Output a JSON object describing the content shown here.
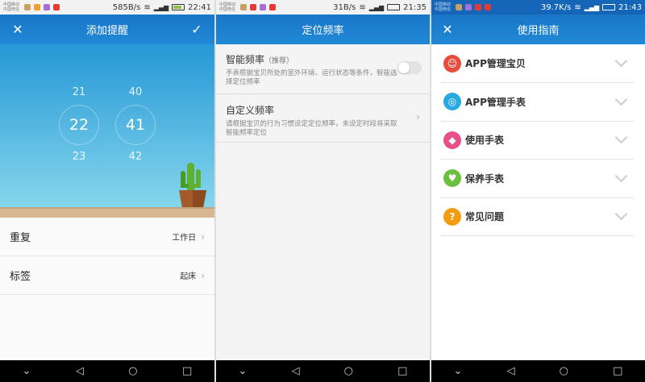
{
  "panel1": {
    "status": {
      "carrier1": "中国移动",
      "carrier2": "中国电信",
      "speed": "585B/s",
      "time": "22:41"
    },
    "title": "添加提醒",
    "close_icon": "close-icon",
    "confirm_icon": "check-icon",
    "hours": [
      "21",
      "22",
      "23"
    ],
    "minutes": [
      "40",
      "41",
      "42"
    ],
    "rows": [
      {
        "label": "重复",
        "value": "工作日"
      },
      {
        "label": "标签",
        "value": "起床"
      }
    ]
  },
  "panel2": {
    "status": {
      "carrier1": "中国移动",
      "carrier2": "中国电信",
      "speed": "31B/s",
      "time": "21:35"
    },
    "title": "定位频率",
    "smart": {
      "title": "智能频率",
      "tag": "（推荐）",
      "desc": "手表根据宝贝所处的室外环境、运行状态等条件，智能选择定位频率",
      "enabled": false
    },
    "custom": {
      "title": "自定义频率",
      "desc": "请根据宝贝的行为习惯设定定位频率，未设定时段将采取智能频率定位"
    }
  },
  "panel3": {
    "status": {
      "carrier1": "中国移动",
      "carrier2": "中国电信",
      "speed": "39.7K/s",
      "time": "21:43"
    },
    "title": "使用指南",
    "items": [
      {
        "label": "APP管理宝贝",
        "color": "#e84c3d",
        "glyph": "☺"
      },
      {
        "label": "APP管理手表",
        "color": "#29a9e1",
        "glyph": "◎"
      },
      {
        "label": "使用手表",
        "color": "#e8508a",
        "glyph": "◆"
      },
      {
        "label": "保养手表",
        "color": "#6cbf3f",
        "glyph": "♥"
      },
      {
        "label": "常见问题",
        "color": "#f39c12",
        "glyph": "?"
      }
    ]
  },
  "nav": {
    "back": "◁",
    "home": "○",
    "recent": "□",
    "down": "⌄"
  }
}
